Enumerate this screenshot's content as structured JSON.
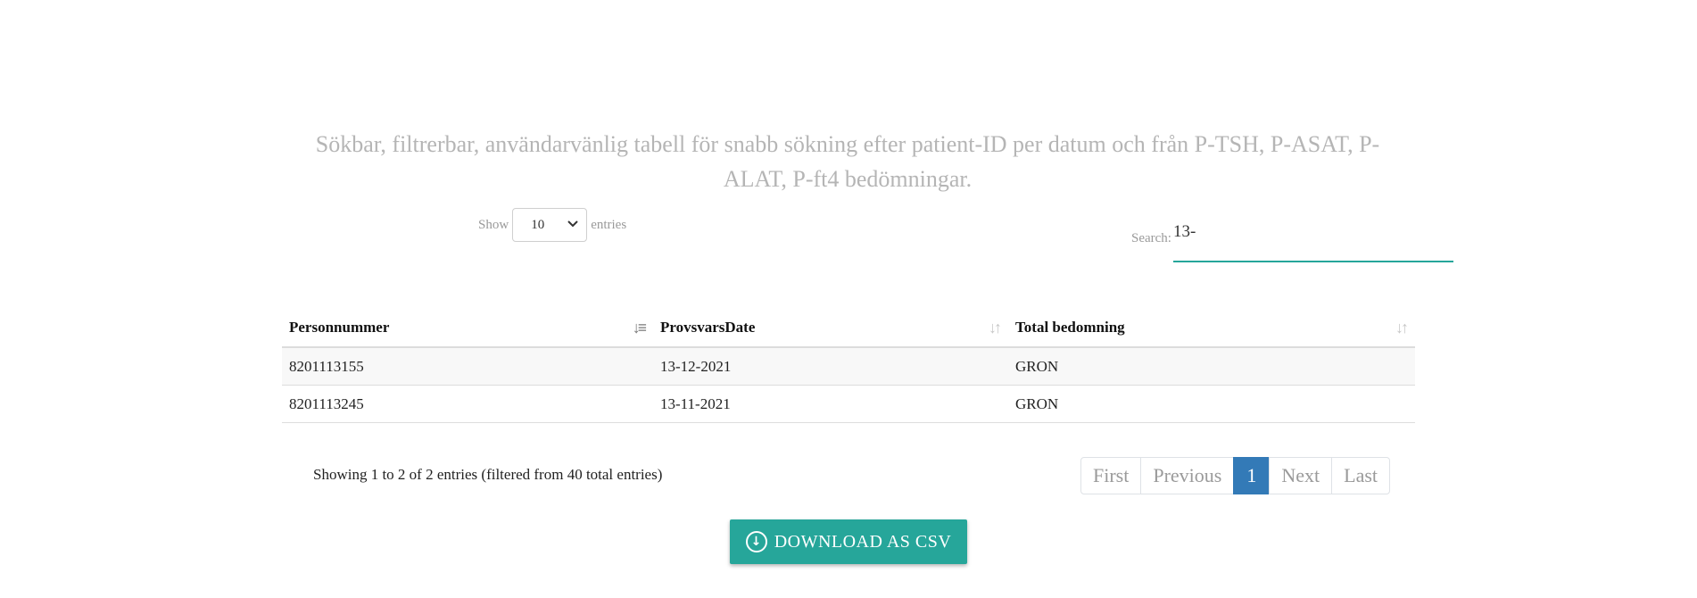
{
  "subtitle": "Sökbar, filtrerbar, användarvänlig tabell för snabb sökning efter patient-ID per datum och från P-TSH, P-ASAT, P-ALAT, P-ft4 bedömningar.",
  "length": {
    "show": "Show",
    "value": "10",
    "entries": "entries"
  },
  "search": {
    "label": "Search:",
    "value": "13-"
  },
  "table": {
    "headers": [
      "Personnummer",
      "ProvsvarsDate",
      "Total bedomning"
    ],
    "rows": [
      [
        "8201113155",
        "13-12-2021",
        "GRON"
      ],
      [
        "8201113245",
        "13-11-2021",
        "GRON"
      ]
    ]
  },
  "info": "Showing 1 to 2 of 2 entries (filtered from 40 total entries)",
  "pagination": {
    "first": "First",
    "previous": "Previous",
    "page": "1",
    "next": "Next",
    "last": "Last"
  },
  "download": {
    "label": "DOWNLOAD AS CSV",
    "icon": "download-circle-icon"
  },
  "colors": {
    "accent": "#26a69a",
    "page_active": "#337ab7"
  }
}
